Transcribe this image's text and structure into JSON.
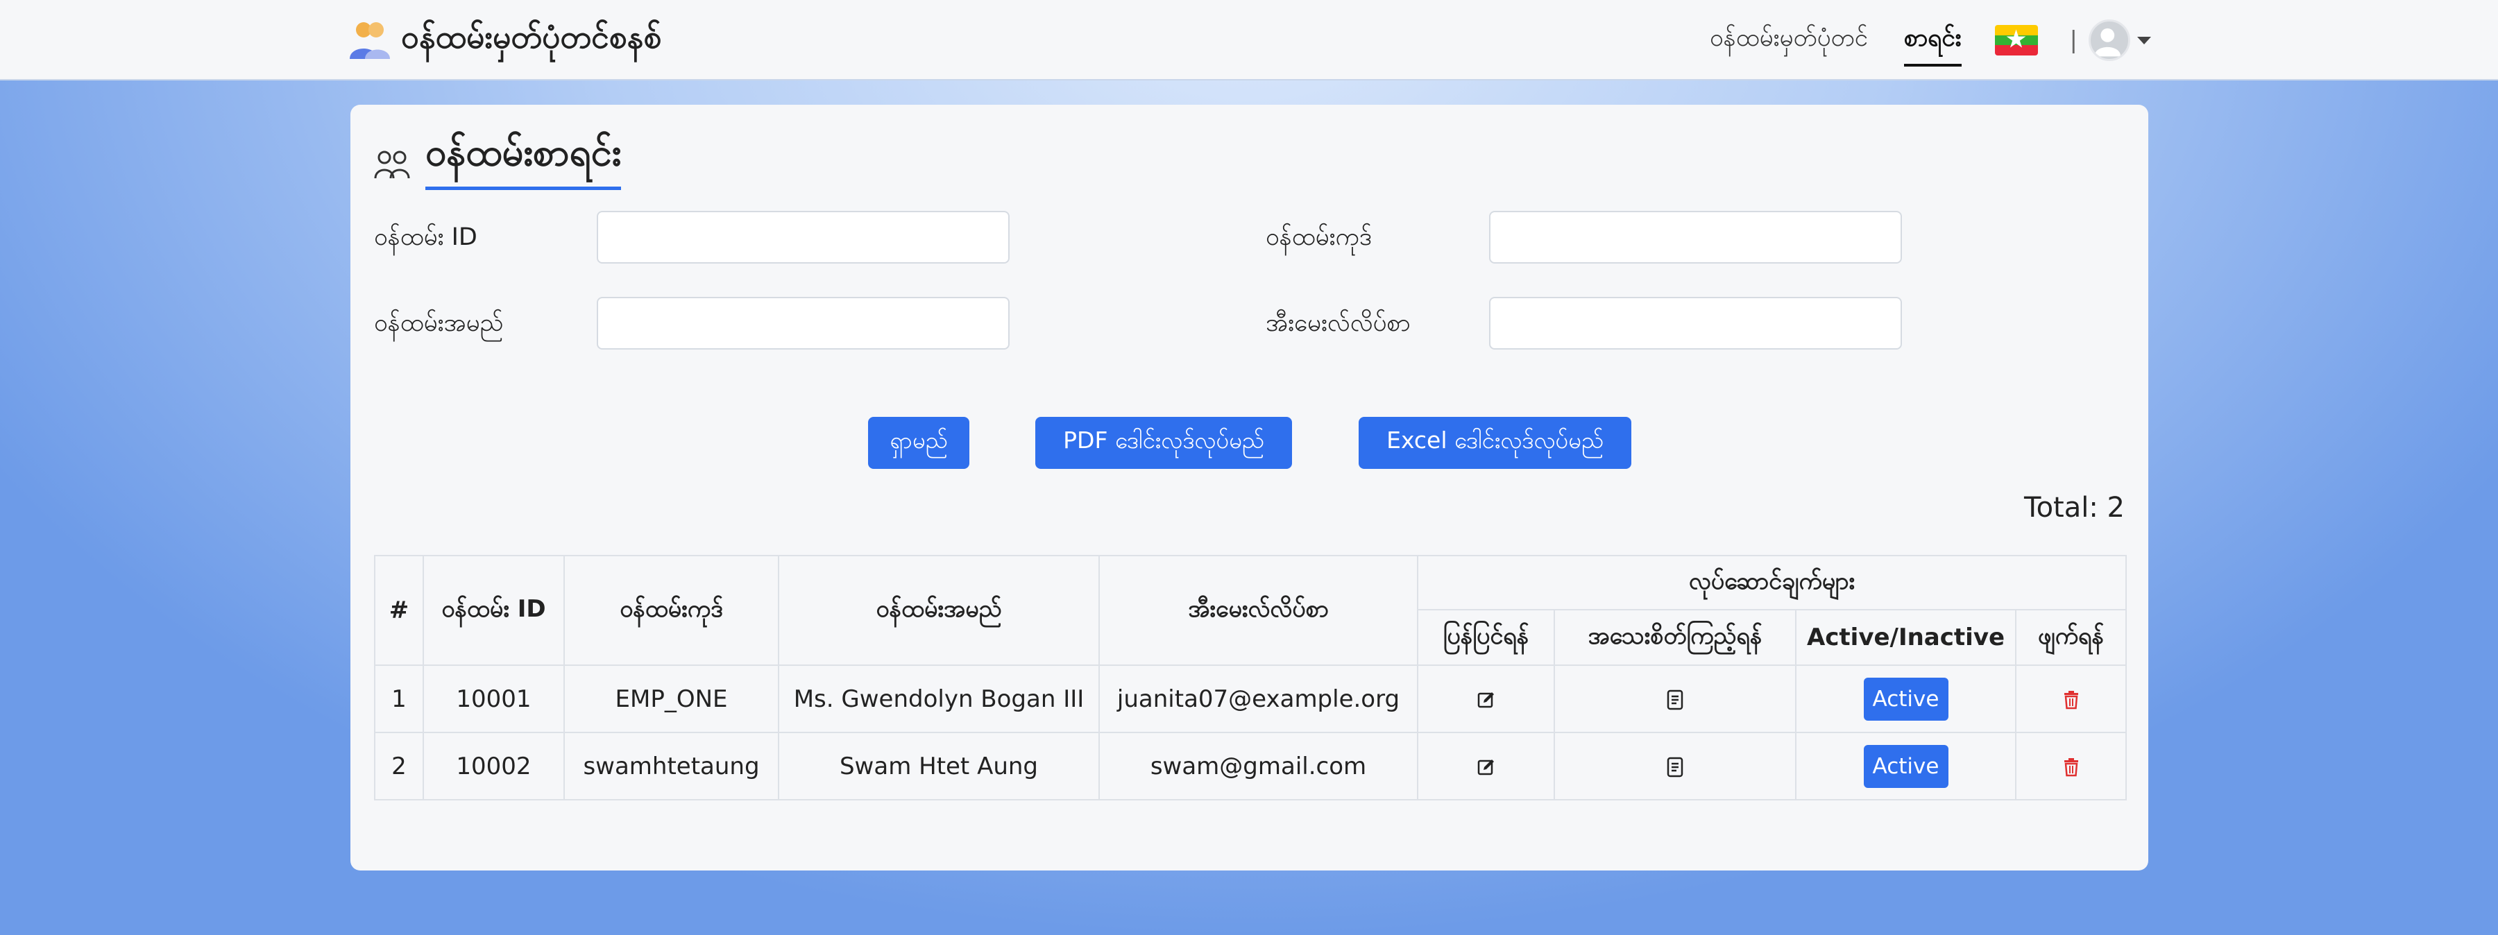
{
  "app": {
    "title": "ဝန်ထမ်းမှတ်ပုံတင်စနစ်"
  },
  "nav": {
    "register_label": "ဝန်ထမ်းမှတ်ပုံတင်",
    "list_label": "စာရင်း",
    "separator": "|"
  },
  "page": {
    "title": "ဝန်ထမ်းစာရင်း"
  },
  "filters": {
    "employee_id_label": "ဝန်ထမ်း ID",
    "employee_id_value": "",
    "employee_code_label": "ဝန်ထမ်းကုဒ်",
    "employee_code_value": "",
    "employee_name_label": "ဝန်ထမ်းအမည်",
    "employee_name_value": "",
    "email_label": "အီးမေးလ်လိပ်စာ",
    "email_value": ""
  },
  "buttons": {
    "search": "ရှာမည်",
    "pdf_download": "PDF ဒေါင်းလုဒ်လုပ်မည်",
    "excel_download": "Excel ဒေါင်းလုဒ်လုပ်မည်"
  },
  "total_text": "Total: 2",
  "table": {
    "headers": {
      "index": "#",
      "employee_id": "ဝန်ထမ်း ID",
      "employee_code": "ဝန်ထမ်းကုဒ်",
      "employee_name": "ဝန်ထမ်းအမည်",
      "email": "အီးမေးလ်လိပ်စာ",
      "actions": "လုပ်ဆောင်ချက်များ",
      "edit": "ပြန်ပြင်ရန်",
      "detail": "အသေးစိတ်ကြည့်ရန်",
      "status": "Active/Inactive",
      "delete": "ဖျက်ရန်"
    },
    "rows": [
      {
        "index": "1",
        "employee_id": "10001",
        "employee_code": "EMP_ONE",
        "employee_name": "Ms. Gwendolyn Bogan III",
        "email": "juanita07@example.org",
        "status": "Active"
      },
      {
        "index": "2",
        "employee_id": "10002",
        "employee_code": "swamhtetaung",
        "employee_name": "Swam Htet Aung",
        "email": "swam@gmail.com",
        "status": "Active"
      }
    ]
  },
  "icons": {
    "brand": "users-group-icon",
    "page_title": "people-outline-icon",
    "flag": "myanmar-flag-icon",
    "avatar": "user-avatar-icon",
    "edit": "edit-icon",
    "detail": "document-icon",
    "delete": "trash-icon"
  },
  "colors": {
    "primary": "#2f6fed",
    "danger": "#e03131",
    "background_center": "#dbe8fb",
    "background_edge": "#6d9be8"
  }
}
